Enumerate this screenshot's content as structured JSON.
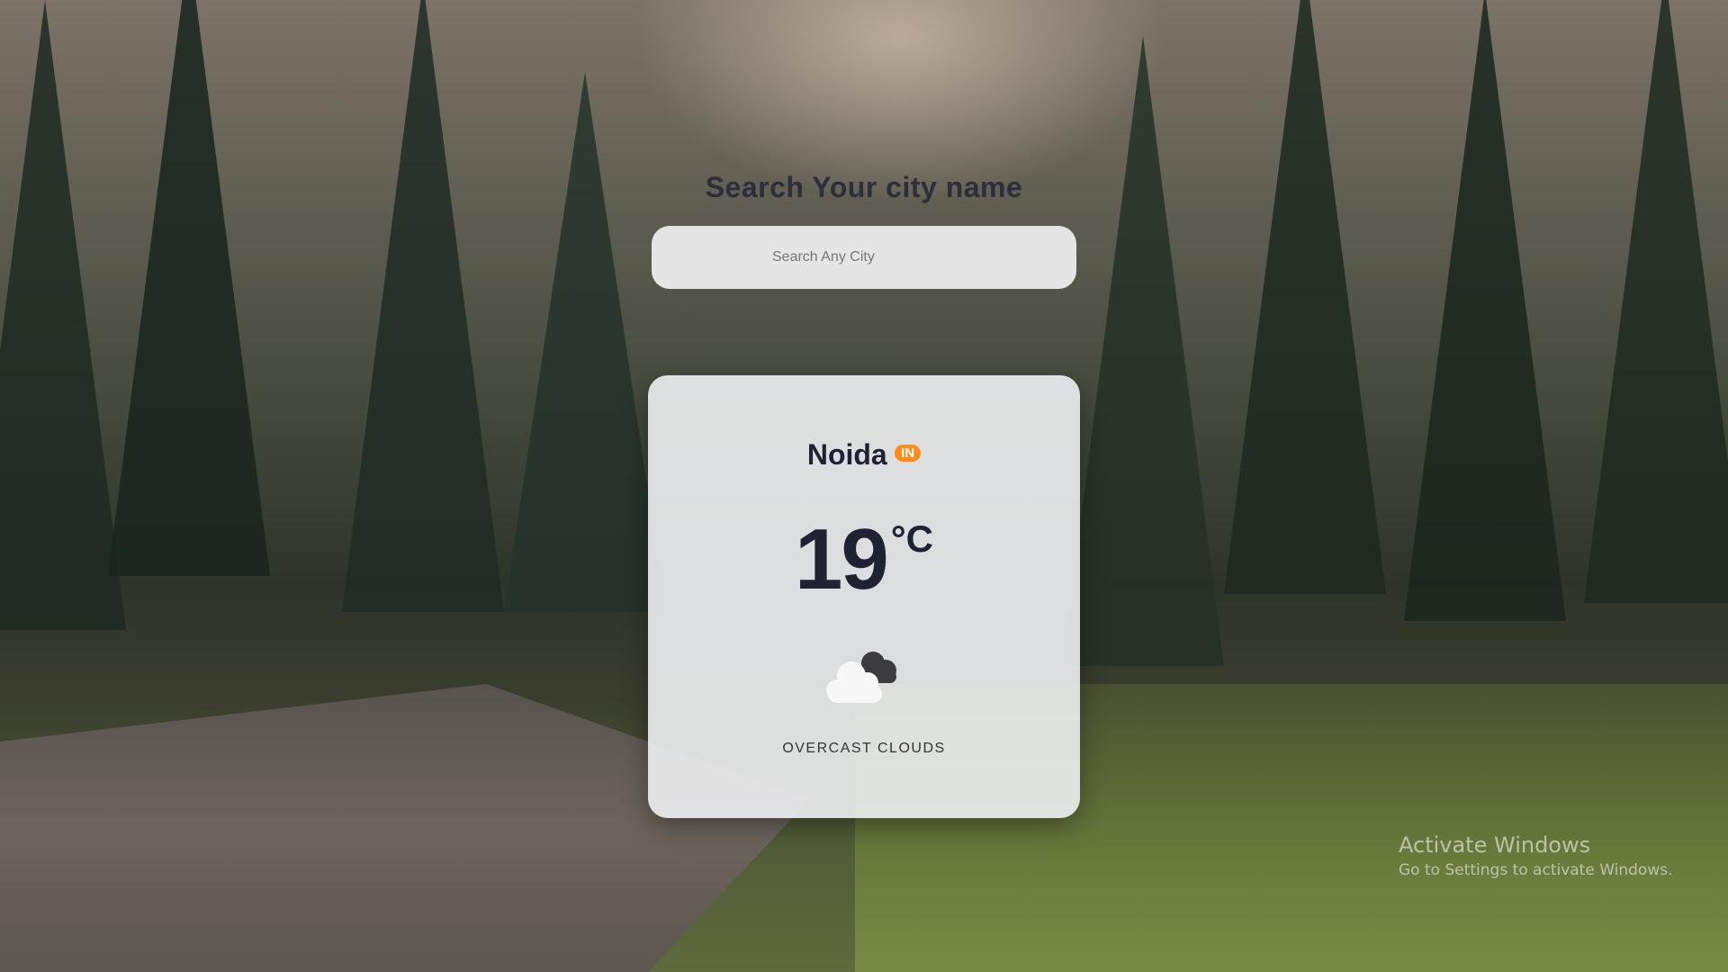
{
  "header": {
    "title": "Search Your city name"
  },
  "search": {
    "placeholder": "Search Any City",
    "value": ""
  },
  "weather": {
    "city": "Noida",
    "country_code": "IN",
    "temperature": "19",
    "unit": "°C",
    "icon": "overcast-clouds-icon",
    "description": "OVERCAST CLOUDS"
  },
  "watermark": {
    "title": "Activate Windows",
    "subtitle": "Go to Settings to activate Windows."
  },
  "colors": {
    "badge": "#ff8c1a",
    "text_dark": "#1f2233",
    "card_bg": "#eeeff2"
  }
}
